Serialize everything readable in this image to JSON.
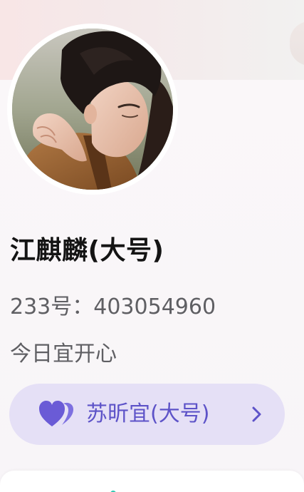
{
  "profile": {
    "nickname": "江麒麟(大号)",
    "id_line": "233号：403054960",
    "signature": "今日宜开心",
    "avatar": "avatar-photo"
  },
  "relation": {
    "icon": "double-heart-icon",
    "label": "苏昕宜(大号)",
    "chevron": "chevron-right-icon",
    "accent_color": "#5d53c8",
    "background_color": "#e5e0f6"
  }
}
